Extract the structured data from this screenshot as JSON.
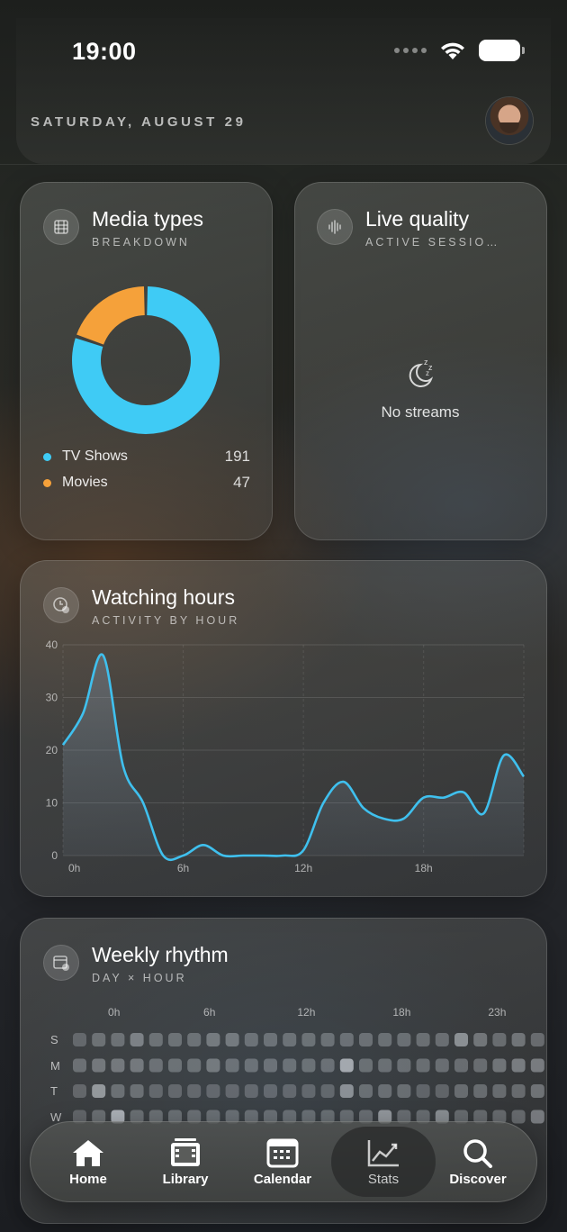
{
  "status_bar": {
    "time": "19:00"
  },
  "header": {
    "date": "SATURDAY, AUGUST 29"
  },
  "media_types": {
    "title": "Media types",
    "subtitle": "BREAKDOWN",
    "items": [
      {
        "label": "TV Shows",
        "value": 191,
        "color": "#3fcbf5"
      },
      {
        "label": "Movies",
        "value": 47,
        "color": "#f5a13a"
      }
    ]
  },
  "live_quality": {
    "title": "Live quality",
    "subtitle": "ACTIVE SESSIO…",
    "empty_text": "No streams"
  },
  "watching_hours": {
    "title": "Watching hours",
    "subtitle": "ACTIVITY BY HOUR"
  },
  "chart_data": {
    "type": "area",
    "x": [
      0,
      1,
      2,
      3,
      4,
      5,
      6,
      7,
      8,
      9,
      10,
      11,
      12,
      13,
      14,
      15,
      16,
      17,
      18,
      19,
      20,
      21,
      22,
      23
    ],
    "x_tick_labels": [
      "0h",
      "6h",
      "12h",
      "18h"
    ],
    "x_tick_positions": [
      0,
      6,
      12,
      18
    ],
    "values": [
      21,
      27,
      38,
      17,
      10,
      0,
      0,
      2,
      0,
      0,
      0,
      0,
      1,
      10,
      14,
      9,
      7,
      7,
      11,
      11,
      12,
      8,
      19,
      15
    ],
    "ylim": [
      0,
      40
    ],
    "y_ticks": [
      0,
      10,
      20,
      30,
      40
    ],
    "grid": true,
    "color": "#3fc0ee"
  },
  "weekly_rhythm": {
    "title": "Weekly rhythm",
    "subtitle": "DAY × HOUR",
    "hour_labels": [
      {
        "label": "0h",
        "col": 2
      },
      {
        "label": "6h",
        "col": 7
      },
      {
        "label": "12h",
        "col": 12
      },
      {
        "label": "18h",
        "col": 17
      },
      {
        "label": "23h",
        "col": 22
      }
    ],
    "days": [
      "S",
      "M",
      "T",
      "W"
    ],
    "levels": [
      [
        0.25,
        0.3,
        0.3,
        0.4,
        0.3,
        0.3,
        0.3,
        0.35,
        0.35,
        0.3,
        0.3,
        0.3,
        0.3,
        0.3,
        0.3,
        0.3,
        0.3,
        0.3,
        0.3,
        0.3,
        0.5,
        0.35,
        0.3,
        0.35,
        0.3
      ],
      [
        0.3,
        0.35,
        0.35,
        0.35,
        0.3,
        0.3,
        0.3,
        0.35,
        0.3,
        0.3,
        0.3,
        0.3,
        0.3,
        0.3,
        0.65,
        0.3,
        0.3,
        0.3,
        0.3,
        0.3,
        0.3,
        0.3,
        0.35,
        0.4,
        0.4
      ],
      [
        0.25,
        0.55,
        0.3,
        0.3,
        0.25,
        0.25,
        0.25,
        0.25,
        0.25,
        0.25,
        0.25,
        0.25,
        0.25,
        0.25,
        0.5,
        0.3,
        0.3,
        0.3,
        0.25,
        0.25,
        0.3,
        0.3,
        0.3,
        0.3,
        0.35
      ],
      [
        0.25,
        0.3,
        0.7,
        0.3,
        0.3,
        0.3,
        0.3,
        0.3,
        0.3,
        0.3,
        0.3,
        0.3,
        0.3,
        0.3,
        0.3,
        0.3,
        0.55,
        0.3,
        0.3,
        0.5,
        0.3,
        0.3,
        0.3,
        0.3,
        0.4
      ]
    ]
  },
  "tab_bar": {
    "tabs": [
      {
        "label": "Home",
        "icon": "house-icon"
      },
      {
        "label": "Library",
        "icon": "film-icon"
      },
      {
        "label": "Calendar",
        "icon": "calendar-icon"
      },
      {
        "label": "Stats",
        "icon": "chart-icon",
        "active": true
      },
      {
        "label": "Discover",
        "icon": "magnifier-icon"
      }
    ]
  }
}
